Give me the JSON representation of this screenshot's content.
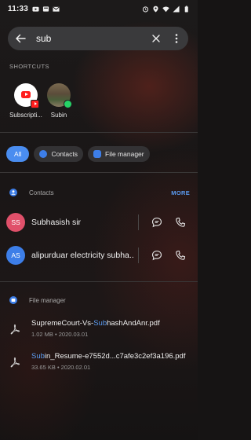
{
  "status_bar": {
    "time": "11:33",
    "left_icons": [
      "youtube-icon",
      "notification-box-icon",
      "gmail-icon"
    ],
    "right_icons": [
      "alarm-icon",
      "location-icon",
      "wifi-icon",
      "signal-icon",
      "battery-icon"
    ]
  },
  "search": {
    "query": "sub",
    "back_icon": "back-arrow-icon",
    "clear_icon": "close-icon",
    "menu_icon": "more-vert-icon"
  },
  "shortcuts": {
    "label": "SHORTCUTS",
    "items": [
      {
        "label": "Subscripti...",
        "icon": "youtube-subscriptions-icon"
      },
      {
        "label": "Subin",
        "icon": "contact-photo-icon"
      }
    ]
  },
  "filters": [
    {
      "label": "All",
      "active": true
    },
    {
      "label": "Contacts",
      "icon": "contacts-icon"
    },
    {
      "label": "File manager",
      "icon": "file-manager-icon"
    }
  ],
  "contacts_section": {
    "title": "Contacts",
    "more_label": "MORE",
    "items": [
      {
        "initials": "SS",
        "name": "Subhasish sir",
        "color": "#e0506a"
      },
      {
        "initials": "AS",
        "name": "alipurduar electricity subha...",
        "color": "#3d7ee8"
      }
    ]
  },
  "files_section": {
    "title": "File manager",
    "items": [
      {
        "name_pre": "SupremeCourt-Vs-",
        "name_hl": "Sub",
        "name_post": "hashAndAnr.pdf",
        "meta": "1.02 MB • 2020.03.01"
      },
      {
        "name_pre": "",
        "name_hl": "Sub",
        "name_post": "in_Resume-e7552d...c7afe3c2ef3a196.pdf",
        "meta": "33.65 KB • 2020.02.01"
      }
    ]
  },
  "colors": {
    "accent": "#4a8df0",
    "link": "#5b9bf0",
    "search_bg": "#3a3a3c"
  }
}
